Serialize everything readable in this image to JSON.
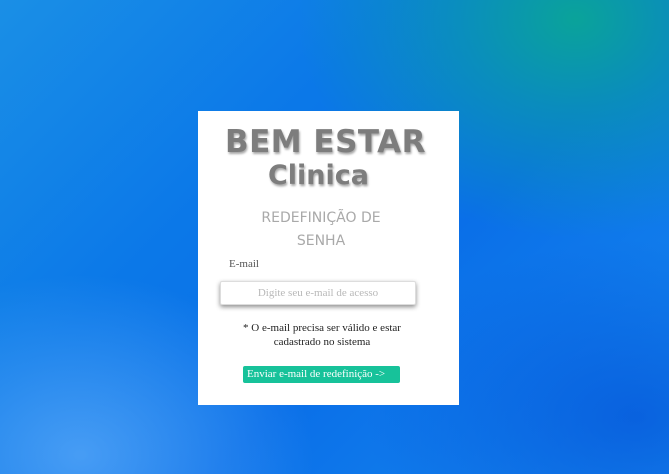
{
  "brand": {
    "line1": "BEM ESTAR",
    "line2": "Clinica"
  },
  "form": {
    "heading_line1": "REDEFINIÇÃO DE",
    "heading_line2": "SENHA",
    "email_label": "E-mail",
    "email_value": "",
    "email_placeholder": "Digite seu e-mail de acesso",
    "note_line1": "* O e-mail precisa ser válido e estar",
    "note_line2": "cadastrado no sistema",
    "submit_label": "Enviar e-mail de redefinição ->"
  },
  "colors": {
    "background": "#0b78e8",
    "card": "#ffffff",
    "logo_text": "#7d7d7d",
    "heading_text": "#a9a9a9",
    "button": "#17c29a"
  }
}
